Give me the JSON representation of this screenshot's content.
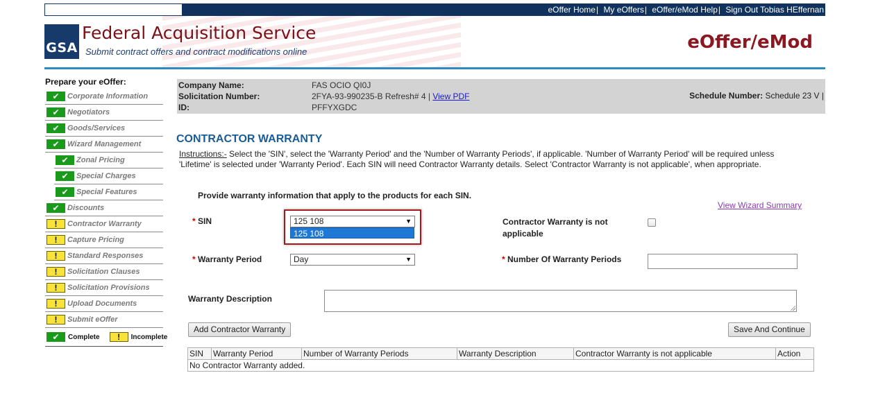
{
  "topnav": {
    "links": [
      {
        "label": "eOffer Home"
      },
      {
        "label": "My eOffers"
      },
      {
        "label": "eOffer/eMod Help"
      },
      {
        "label": "Sign Out Tobias HEffernan"
      }
    ],
    "separator": "|"
  },
  "header": {
    "logo_text": "GSA",
    "title": "Federal Acquisition Service",
    "tagline": "Submit contract offers and contract modifications online",
    "app_name": "eOffer/eMod",
    "colors": {
      "nav_bar": "#12325e",
      "title": "#7a1018",
      "rule": "#2a8bbf"
    }
  },
  "sidebar": {
    "heading": "Prepare your eOffer:",
    "items": [
      {
        "label": "Corporate Information",
        "status": "complete",
        "icon": "checkmark-icon",
        "sub": false
      },
      {
        "label": "Negotiators",
        "status": "complete",
        "icon": "checkmark-icon",
        "sub": false
      },
      {
        "label": "Goods/Services",
        "status": "complete",
        "icon": "checkmark-icon",
        "sub": false
      },
      {
        "label": "Wizard Management",
        "status": "complete",
        "icon": "checkmark-icon",
        "sub": false
      },
      {
        "label": "Zonal Pricing",
        "status": "complete",
        "icon": "checkmark-icon",
        "sub": true
      },
      {
        "label": "Special Charges",
        "status": "complete",
        "icon": "checkmark-icon",
        "sub": true
      },
      {
        "label": "Special Features",
        "status": "complete",
        "icon": "checkmark-icon",
        "sub": true
      },
      {
        "label": "Discounts",
        "status": "complete",
        "icon": "checkmark-icon",
        "sub": false
      },
      {
        "label": "Contractor Warranty",
        "status": "incomplete",
        "icon": "exclamation-icon",
        "sub": false
      },
      {
        "label": "Capture Pricing",
        "status": "incomplete",
        "icon": "exclamation-icon",
        "sub": false
      },
      {
        "label": "Standard Responses",
        "status": "incomplete",
        "icon": "exclamation-icon",
        "sub": false
      },
      {
        "label": "Solicitation Clauses",
        "status": "incomplete",
        "icon": "exclamation-icon",
        "sub": false
      },
      {
        "label": "Solicitation Provisions",
        "status": "incomplete",
        "icon": "exclamation-icon",
        "sub": false
      },
      {
        "label": "Upload Documents",
        "status": "incomplete",
        "icon": "exclamation-icon",
        "sub": false
      },
      {
        "label": "Submit eOffer",
        "status": "incomplete",
        "icon": "exclamation-icon",
        "sub": false
      }
    ],
    "legend": {
      "complete": "Complete",
      "incomplete": "Incomplete"
    },
    "colors": {
      "complete": "#1a9a1a",
      "incomplete": "#f7e33a"
    }
  },
  "info": {
    "company_label": "Company Name:",
    "company_value": "FAS OCIO QI0J",
    "solicitation_label": "Solicitation Number:",
    "solicitation_value": "2FYA-93-990235-B Refresh# 4 |",
    "pdf_link": "View PDF",
    "id_label": "ID:",
    "id_value": "PFFYXGDC",
    "schedule_label": "Schedule Number:",
    "schedule_value": "Schedule 23 V |"
  },
  "main": {
    "title": "CONTRACTOR WARRANTY",
    "instructions_label": "Instructions:-",
    "instructions_text": " Select the 'SIN', select the 'Warranty Period' and the 'Number of Warranty Periods', if applicable. 'Number of Warranty Period' will be required unless 'Lifetime' is selected under 'Warranty Period'. Each SIN will need Contractor Warranty details. Select 'Contractor Warranty is not applicable', when appropriate.",
    "subheading": "Provide warranty information that apply to the products for each SIN.",
    "summary_link": "View Wizard Summary",
    "required_mark": "*",
    "sin": {
      "label": "SIN",
      "value": "125 108",
      "options": [
        "125 108"
      ]
    },
    "warranty_period": {
      "label": "Warranty Period",
      "value": "Day"
    },
    "not_applicable": {
      "label_line1": "Contractor Warranty is not",
      "label_line2": "applicable",
      "checked": false
    },
    "num_periods": {
      "label": "Number Of Warranty Periods",
      "value": ""
    },
    "description": {
      "label": "Warranty Description",
      "value": ""
    },
    "add_button": "Add Contractor Warranty",
    "save_button": "Save And Continue",
    "table": {
      "columns": [
        "SIN",
        "Warranty Period",
        "Number of Warranty Periods",
        "Warranty Description",
        "Contractor Warranty is not applicable",
        "Action"
      ],
      "empty_message": "No Contractor Warranty added."
    },
    "colors": {
      "title": "#1a5c98",
      "highlight": "#a3191c",
      "selected_option": "#1e78d6"
    }
  }
}
